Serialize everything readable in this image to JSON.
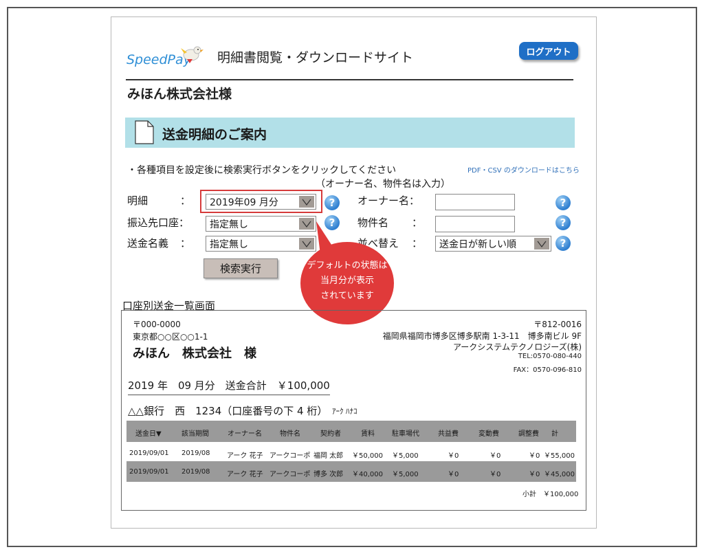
{
  "header": {
    "logo_text": "SpeedPay",
    "site_title": "明細書閲覧・ダウンロードサイト",
    "logout_label": "ログアウト"
  },
  "company_title": "みほん株式会社様",
  "banner": {
    "title": "送金明細のご案内"
  },
  "instructions": {
    "line1": "・各種項目を設定後に検索実行ボタンをクリックしてください",
    "line2": "（オーナー名、物件名は入力）",
    "download_link": "PDF・CSV のダウンロードはこちら"
  },
  "form": {
    "colon": "：",
    "statement_label": "明細",
    "statement_value": "2019年09 月分",
    "bank_label": "振込先口座：",
    "bank_value": "指定無し",
    "sender_label": "送金名義",
    "sender_value": "指定無し",
    "owner_label": "オーナー名：",
    "property_label": "物件名",
    "sort_label": "並べ替え",
    "sort_value": "送金日が新しい順",
    "search_label": "検索実行",
    "help_glyph": "?"
  },
  "callout": {
    "line1": "デフォルトの状態は",
    "line2": "当月分が表示",
    "line3": "されています"
  },
  "list_section_label": "口座別送金一覧画面",
  "recipient": {
    "postal": "〒000-0000",
    "address": "東京都○○区○○1-1",
    "name": "みほん　株式会社　様"
  },
  "sender": {
    "postal": "〒812-0016",
    "address": "福岡県福岡市博多区博多駅南 1-3-11　博多南ビル 9F",
    "company": "アークシステムテクノロジーズ(株)",
    "tel": "TEL:0570-080-440",
    "fax": "FAX：0570-096-810"
  },
  "total_line": "2019 年　09 月分　送金合計　￥100,000",
  "bank_line": "△△銀行　西　1234（口座番号の下 4 桁）",
  "bank_kana": "ｱｰｸ ﾊﾅｺ",
  "table": {
    "headers": [
      "送金日▼",
      "該当期間",
      "オーナー名",
      "物件名",
      "契約者",
      "賃料",
      "駐車場代",
      "共益費",
      "変動費",
      "調整費",
      "計"
    ],
    "rows": [
      [
        "2019/09/01",
        "2019/08",
        "アーク 花子",
        "アークコーポ",
        "福岡 太郎",
        "￥50,000",
        "￥5,000",
        "￥0",
        "￥0",
        "￥0",
        "￥55,000"
      ],
      [
        "2019/09/01",
        "2019/08",
        "アーク 花子",
        "アークコーポ",
        "博多 次郎",
        "￥40,000",
        "￥5,000",
        "￥0",
        "￥0",
        "￥0",
        "￥45,000"
      ]
    ],
    "subtotal": "小計　￥100,000"
  },
  "colors": {
    "banner": "#b2e0e8",
    "logout": "#1f6fc6",
    "highlight": "#d63a3a",
    "callout": "#e03a3a",
    "table_header": "#9a9a9a"
  }
}
